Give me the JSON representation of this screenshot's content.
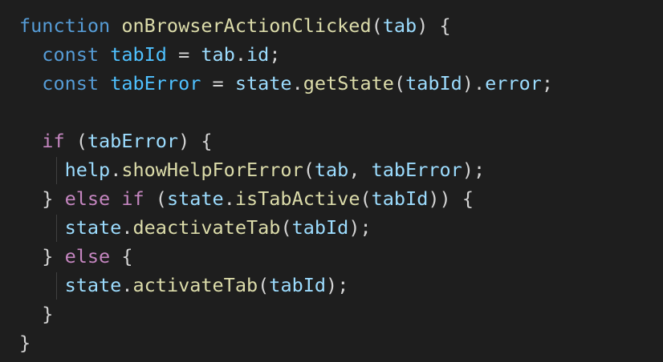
{
  "editor": {
    "background_color": "#1e1e1e",
    "language": "javascript",
    "lines": [
      [
        {
          "t": "function",
          "c": "kw"
        },
        {
          "t": " ",
          "c": "pun"
        },
        {
          "t": "onBrowserActionClicked",
          "c": "fn"
        },
        {
          "t": "(",
          "c": "pun"
        },
        {
          "t": "tab",
          "c": "var"
        },
        {
          "t": ") {",
          "c": "pun"
        }
      ],
      [
        {
          "t": "  ",
          "c": "pun"
        },
        {
          "t": "const",
          "c": "kw"
        },
        {
          "t": " ",
          "c": "pun"
        },
        {
          "t": "tabId",
          "c": "obj"
        },
        {
          "t": " = ",
          "c": "pun"
        },
        {
          "t": "tab",
          "c": "var"
        },
        {
          "t": ".",
          "c": "pun"
        },
        {
          "t": "id",
          "c": "var"
        },
        {
          "t": ";",
          "c": "pun"
        }
      ],
      [
        {
          "t": "  ",
          "c": "pun"
        },
        {
          "t": "const",
          "c": "kw"
        },
        {
          "t": " ",
          "c": "pun"
        },
        {
          "t": "tabError",
          "c": "obj"
        },
        {
          "t": " = ",
          "c": "pun"
        },
        {
          "t": "state",
          "c": "var"
        },
        {
          "t": ".",
          "c": "pun"
        },
        {
          "t": "getState",
          "c": "fn"
        },
        {
          "t": "(",
          "c": "pun"
        },
        {
          "t": "tabId",
          "c": "var"
        },
        {
          "t": ").",
          "c": "pun"
        },
        {
          "t": "error",
          "c": "var"
        },
        {
          "t": ";",
          "c": "pun"
        }
      ],
      [],
      [
        {
          "t": "  ",
          "c": "pun"
        },
        {
          "t": "if",
          "c": "ctl"
        },
        {
          "t": " (",
          "c": "pun"
        },
        {
          "t": "tabError",
          "c": "var"
        },
        {
          "t": ") {",
          "c": "pun"
        }
      ],
      [
        {
          "t": "    ",
          "c": "pun"
        },
        {
          "t": "help",
          "c": "var"
        },
        {
          "t": ".",
          "c": "pun"
        },
        {
          "t": "showHelpForError",
          "c": "fn"
        },
        {
          "t": "(",
          "c": "pun"
        },
        {
          "t": "tab",
          "c": "var"
        },
        {
          "t": ", ",
          "c": "pun"
        },
        {
          "t": "tabError",
          "c": "var"
        },
        {
          "t": ");",
          "c": "pun"
        }
      ],
      [
        {
          "t": "  } ",
          "c": "pun"
        },
        {
          "t": "else",
          "c": "ctl"
        },
        {
          "t": " ",
          "c": "pun"
        },
        {
          "t": "if",
          "c": "ctl"
        },
        {
          "t": " (",
          "c": "pun"
        },
        {
          "t": "state",
          "c": "var"
        },
        {
          "t": ".",
          "c": "pun"
        },
        {
          "t": "isTabActive",
          "c": "fn"
        },
        {
          "t": "(",
          "c": "pun"
        },
        {
          "t": "tabId",
          "c": "var"
        },
        {
          "t": ")) {",
          "c": "pun"
        }
      ],
      [
        {
          "t": "    ",
          "c": "pun"
        },
        {
          "t": "state",
          "c": "var"
        },
        {
          "t": ".",
          "c": "pun"
        },
        {
          "t": "deactivateTab",
          "c": "fn"
        },
        {
          "t": "(",
          "c": "pun"
        },
        {
          "t": "tabId",
          "c": "var"
        },
        {
          "t": ");",
          "c": "pun"
        }
      ],
      [
        {
          "t": "  } ",
          "c": "pun"
        },
        {
          "t": "else",
          "c": "ctl"
        },
        {
          "t": " {",
          "c": "pun"
        }
      ],
      [
        {
          "t": "    ",
          "c": "pun"
        },
        {
          "t": "state",
          "c": "var"
        },
        {
          "t": ".",
          "c": "pun"
        },
        {
          "t": "activateTab",
          "c": "fn"
        },
        {
          "t": "(",
          "c": "pun"
        },
        {
          "t": "tabId",
          "c": "var"
        },
        {
          "t": ");",
          "c": "pun"
        }
      ],
      [
        {
          "t": "  }",
          "c": "pun"
        }
      ],
      [
        {
          "t": "}",
          "c": "pun"
        }
      ]
    ]
  }
}
